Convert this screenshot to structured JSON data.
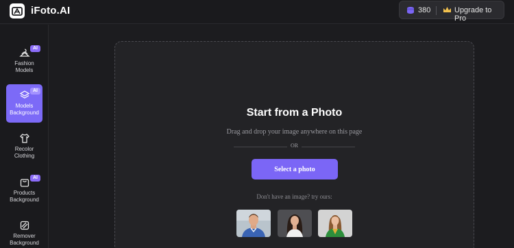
{
  "app": {
    "brand": "iFoto.AI"
  },
  "account": {
    "credits": "380",
    "upgrade_label": "Upgrade to Pro"
  },
  "sidebar": {
    "items": [
      {
        "label": "Fashion Models",
        "badge": "AI",
        "icon": "hanger-icon"
      },
      {
        "label": "Models Background",
        "badge": "AI",
        "icon": "layers-icon",
        "active": true
      },
      {
        "label": "Recolor Clothing",
        "icon": "shirt-icon"
      },
      {
        "label": "Products Background",
        "badge": "AI",
        "icon": "bag-icon"
      },
      {
        "label": "Remover Background",
        "icon": "eraser-icon"
      }
    ]
  },
  "main": {
    "title": "Start from a Photo",
    "subtitle": "Drag and drop your image anywhere on this page",
    "or_label": "OR",
    "select_button": "Select a photo",
    "try_label": "Don't have an image? try ours:",
    "samples": [
      "man in blue shirt",
      "woman in white top",
      "woman in green jacket"
    ]
  },
  "colors": {
    "accent": "#7b66f6",
    "badge": "#8b6cf8",
    "background": "#1c1c1f",
    "panel": "#232326"
  }
}
